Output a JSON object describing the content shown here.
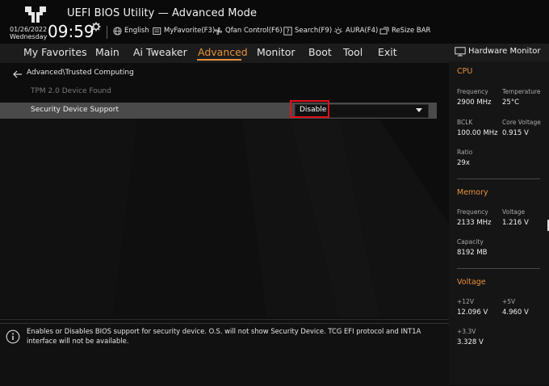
{
  "app": {
    "title": "UEFI BIOS Utility — Advanced Mode"
  },
  "clock": {
    "date": "01/26/2022",
    "day": "Wednesday",
    "time": "09:59"
  },
  "toolbar": {
    "english": "English",
    "myfavorite": "MyFavorite(F3)",
    "qfan": "Qfan Control(F6)",
    "search": "Search(F9)",
    "aura": "AURA(F4)",
    "resize": "ReSize BAR"
  },
  "nav": {
    "tabs": [
      "My Favorites",
      "Main",
      "Ai Tweaker",
      "Advanced",
      "Monitor",
      "Boot",
      "Tool",
      "Exit"
    ],
    "active": "Advanced"
  },
  "page": {
    "breadcrumb": "Advanced\\Trusted Computing",
    "tpm_label": "TPM 2.0 Device Found",
    "security_label": "Security Device Support",
    "security_value": "Disable"
  },
  "help": {
    "text": "Enables or Disables BIOS support for security device. O.S. will not show Security Device. TCG EFI protocol and INT1A interface will not be available."
  },
  "hwm": {
    "title": "Hardware Monitor",
    "cpu": {
      "heading": "CPU",
      "frequency_label": "Frequency",
      "frequency": "2900 MHz",
      "temperature_label": "Temperature",
      "temperature": "25°C",
      "bclk_label": "BCLK",
      "bclk": "100.00 MHz",
      "core_voltage_label": "Core Voltage",
      "core_voltage": "0.915 V",
      "ratio_label": "Ratio",
      "ratio": "29x"
    },
    "memory": {
      "heading": "Memory",
      "frequency_label": "Frequency",
      "frequency": "2133 MHz",
      "voltage_label": "Voltage",
      "voltage": "1.216 V",
      "capacity_label": "Capacity",
      "capacity": "8192 MB"
    },
    "voltage": {
      "heading": "Voltage",
      "v12_label": "+12V",
      "v12": "12.096 V",
      "v5_label": "+5V",
      "v5": "4.960 V",
      "v33_label": "+3.3V",
      "v33": "3.328 V"
    }
  },
  "colors": {
    "accent": "#e8913a",
    "highlight": "#e0101a",
    "row_selected": "#4a4a4a"
  }
}
